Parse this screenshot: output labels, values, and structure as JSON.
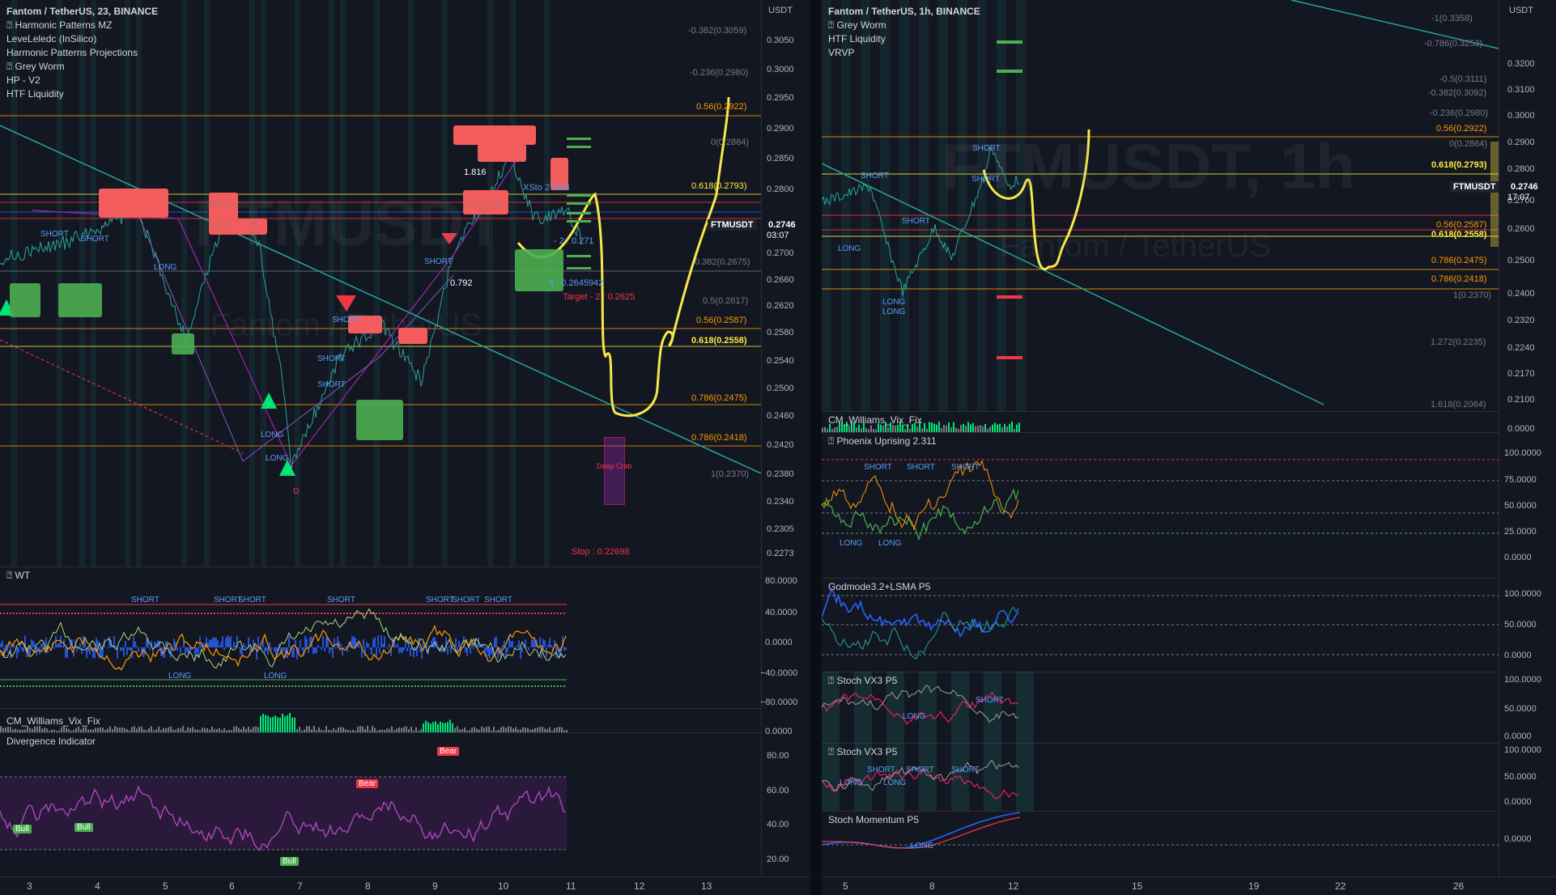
{
  "left_chart": {
    "legend": [
      "Fantom / TetherUS, 23, BINANCE",
      "⍰ Harmonic Patterns MZ",
      "LeveLeledc (InSilico)",
      "Harmonic Patterns Projections",
      "⍰ Grey Worm",
      "HP - V2",
      "HTF Liquidity"
    ],
    "axis_unit": "USDT",
    "symbol_badge": "FTMUSDT",
    "last_price": "0.2746",
    "countdown": "03:07",
    "price_ticks": [
      "0.3050",
      "0.3000",
      "0.2950",
      "0.2900",
      "0.2850",
      "0.2800",
      "0.2700",
      "0.2660",
      "0.2620",
      "0.2580",
      "0.2540",
      "0.2500",
      "0.2460",
      "0.2420",
      "0.2380",
      "0.2340",
      "0.2305",
      "0.2273"
    ],
    "fib_levels": [
      {
        "label": "-0.382(0.3059)",
        "color": "#787b86"
      },
      {
        "label": "-0.236(0.2980)",
        "color": "#787b86"
      },
      {
        "label": "0.56(0.2922)",
        "color": "#ff9800"
      },
      {
        "label": "0(0.2864)",
        "color": "#787b86"
      },
      {
        "label": "0.618(0.2793)",
        "color": "#ffeb3b"
      },
      {
        "label": "0.382(0.2675)",
        "color": "#787b86"
      },
      {
        "label": "0.5(0.2617)",
        "color": "#787b86"
      },
      {
        "label": "0.56(0.2587)",
        "color": "#ff9800"
      },
      {
        "label": "0.618(0.2558)",
        "color": "#ffeb3b"
      },
      {
        "label": "0.786(0.2475)",
        "color": "#ff9800"
      },
      {
        "label": "0.786(0.2418)",
        "color": "#ff9800"
      },
      {
        "label": "1(0.2370)",
        "color": "#787b86"
      }
    ],
    "annotations": {
      "target": "Target - 2 : 0.2625",
      "target2": "- 2 : 0.271",
      "level4": "4 : 0.2645942",
      "xstop": "XSto 27938",
      "stop": "Stop : 0.22698",
      "deep_crab": "Deep Crab",
      "ext_ratio": "1.816",
      "ratio_792": "0.792",
      "pt_d": "D"
    },
    "time_ticks": [
      "3",
      "4",
      "5",
      "6",
      "7",
      "8",
      "9",
      "10",
      "11",
      "12",
      "13"
    ],
    "wt_pane": {
      "title": "⍰ WT",
      "ticks": [
        "80.0000",
        "40.0000",
        "0.0000",
        "−40.0000",
        "−80.0000"
      ]
    },
    "vix_pane": {
      "title": "CM_Williams_Vix_Fix",
      "ticks": [
        "0.0000"
      ]
    },
    "div_pane": {
      "title": "Divergence Indicator",
      "ticks": [
        "80.00",
        "60.00",
        "40.00",
        "20.00"
      ],
      "bull": "Bull",
      "bear": "Bear"
    },
    "short_label": "SHORT",
    "long_label": "LONG",
    "watermark_sub": "Fantom / TetherUS"
  },
  "right_chart": {
    "legend": [
      "Fantom / TetherUS, 1h, BINANCE",
      "⍰ Grey Worm",
      "HTF Liquidity",
      "VRVP"
    ],
    "axis_unit": "USDT",
    "symbol_badge": "FTMUSDT",
    "last_price": "0.2746",
    "countdown": "17:07",
    "watermark": "FTMUSDT, 1h",
    "watermark_sub": "Fantom / TetherUS",
    "price_ticks": [
      "0.3200",
      "0.3100",
      "0.3000",
      "0.2900",
      "0.2800",
      "0.2700",
      "0.2600",
      "0.2500",
      "0.2400",
      "0.2320",
      "0.2240",
      "0.2170",
      "0.2100",
      "0.0000"
    ],
    "fib_levels": [
      {
        "label": "-1(0.3358)",
        "color": "#787b86"
      },
      {
        "label": "-0.786(0.3253)",
        "color": "#787b86"
      },
      {
        "label": "-0.5(0.3111)",
        "color": "#787b86"
      },
      {
        "label": "-0.382(0.3092)",
        "color": "#787b86"
      },
      {
        "label": "-0.236(0.2980)",
        "color": "#787b86"
      },
      {
        "label": "0.56(0.2922)",
        "color": "#ff9800"
      },
      {
        "label": "0(0.2864)",
        "color": "#787b86"
      },
      {
        "label": "0.618(0.2793)",
        "color": "#ffeb3b"
      },
      {
        "label": "0.56(0.2587)",
        "color": "#ff9800"
      },
      {
        "label": "0.618(0.2558)",
        "color": "#ffeb3b"
      },
      {
        "label": "0.786(0.2475)",
        "color": "#ff9800"
      },
      {
        "label": "0.786(0.2418)",
        "color": "#ff9800"
      },
      {
        "label": "1(0.2370)",
        "color": "#787b86"
      },
      {
        "label": "1.272(0.2235)",
        "color": "#787b86"
      },
      {
        "label": "1.618(0.2064)",
        "color": "#787b86"
      }
    ],
    "time_ticks": [
      "5",
      "8",
      "12",
      "15",
      "19",
      "22",
      "26"
    ],
    "vix_pane": {
      "title": "CM_Williams_Vix_Fix"
    },
    "phoenix_pane": {
      "title": "⍰ Phoenix Uprising 2.311",
      "ticks": [
        "100.0000",
        "75.0000",
        "50.0000",
        "25.0000",
        "0.0000"
      ]
    },
    "godmode_pane": {
      "title": "Godmode3.2+LSMA P5",
      "ticks": [
        "100.0000",
        "50.0000",
        "0.0000"
      ]
    },
    "stoch1_pane": {
      "title": "⍰ Stoch VX3 P5",
      "ticks": [
        "100.0000",
        "50.0000",
        "0.0000"
      ]
    },
    "stoch2_pane": {
      "title": "⍰ Stoch VX3 P5",
      "ticks": [
        "100.0000",
        "50.0000",
        "0.0000"
      ]
    },
    "momentum_pane": {
      "title": "Stoch Momentum P5",
      "ticks": [
        "0.0000"
      ]
    },
    "short_label": "SHORT",
    "long_label": "LONG"
  },
  "colors": {
    "background": "#131722",
    "grid": "#2a2e39",
    "yellow_draw": "#f7e84a",
    "fib_orange": "#ff9800",
    "fib_yellow": "#ffeb3b",
    "red": "#f23645",
    "green": "#4caf50",
    "teal": "#26a69a",
    "blue_label": "#5b9cf6",
    "purple": "#9c27b0"
  }
}
